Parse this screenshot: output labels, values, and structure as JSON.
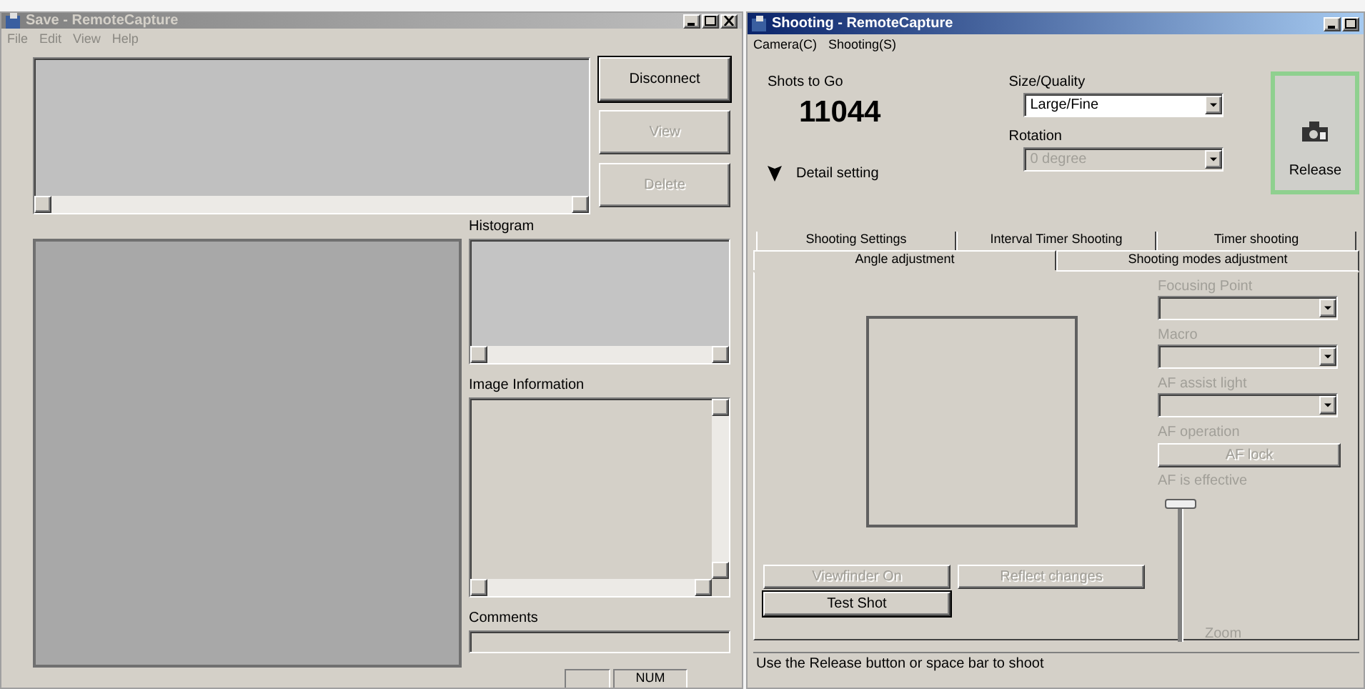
{
  "save_window": {
    "title": "Save - RemoteCapture",
    "active": false,
    "menu": [
      "File",
      "Edit",
      "View",
      "Help"
    ],
    "buttons": [
      {
        "label": "Disconnect",
        "disabled": false
      },
      {
        "label": "View",
        "disabled": true
      },
      {
        "label": "Delete",
        "disabled": true
      }
    ],
    "histogram_label": "Histogram",
    "image_information_label": "Image Information",
    "comments_label": "Comments",
    "status_bar": [
      "NUM"
    ]
  },
  "shooting_window": {
    "title": "Shooting - RemoteCapture",
    "active": true,
    "menu": [
      "Camera(C)",
      "Shooting(S)"
    ],
    "shots_to_go_label": "Shots to Go",
    "shots_to_go": "11044",
    "size_quality": {
      "label": "Size/Quality",
      "value": "Large/Fine",
      "disabled": false
    },
    "rotation": {
      "label": "Rotation",
      "value": "0 degree",
      "disabled": true
    },
    "release_button": "Release",
    "detail_setting": {
      "label": "Detail setting",
      "expanded": true
    },
    "tab_rows": [
      [
        {
          "label": "Shooting Settings",
          "selected": false
        },
        {
          "label": "Interval Timer Shooting",
          "selected": false
        },
        {
          "label": "Timer shooting",
          "selected": false
        }
      ],
      [
        {
          "label": "Angle adjustment",
          "selected": true
        },
        {
          "label": "Shooting modes adjustment",
          "selected": false
        }
      ]
    ],
    "focus_controls": [
      {
        "kind": "select",
        "label": "Focusing Point",
        "disabled": true
      },
      {
        "kind": "select",
        "label": "Macro",
        "disabled": true
      },
      {
        "kind": "select",
        "label": "AF assist light",
        "disabled": true
      },
      {
        "kind": "label",
        "label": "AF operation",
        "disabled": true
      },
      {
        "kind": "button",
        "label": "AF lock",
        "disabled": true
      },
      {
        "kind": "label",
        "label": "AF is effective",
        "disabled": true
      }
    ],
    "zoom": {
      "label": "Zoom",
      "level": 1,
      "disabled": true
    },
    "buttons": [
      {
        "label": "Viewfinder On",
        "disabled": true
      },
      {
        "label": "Reflect changes",
        "disabled": true
      },
      {
        "label": "Test Shot",
        "disabled": false
      }
    ],
    "status": "Use the Release button or space bar to shoot"
  }
}
